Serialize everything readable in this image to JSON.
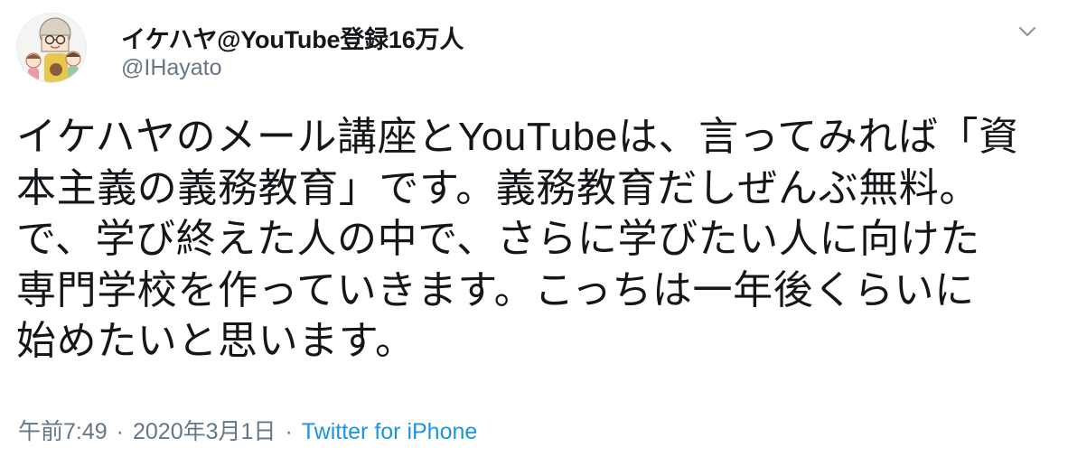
{
  "author": {
    "display_name": "イケハヤ@YouTube登録16万人",
    "handle": "@IHayato"
  },
  "tweet": {
    "lines": [
      "イケハヤのメール講座とYouTubeは、言ってみれば「資",
      "本主義の義務教育」です。義務教育だしぜんぶ無料。",
      "で、学び終えた人の中で、さらに学びたい人に向けた",
      "専門学校を作っていきます。こっちは一年後くらいに",
      "始めたいと思います。"
    ]
  },
  "meta": {
    "time": "午前7:49",
    "separator": "·",
    "date": "2020年3月1日",
    "source": "Twitter for iPhone"
  },
  "icons": {
    "avatar": "avatar-illustration",
    "menu": "chevron-down-icon"
  },
  "colors": {
    "text": "#14171a",
    "secondary": "#657786",
    "link": "#1b95e0"
  }
}
